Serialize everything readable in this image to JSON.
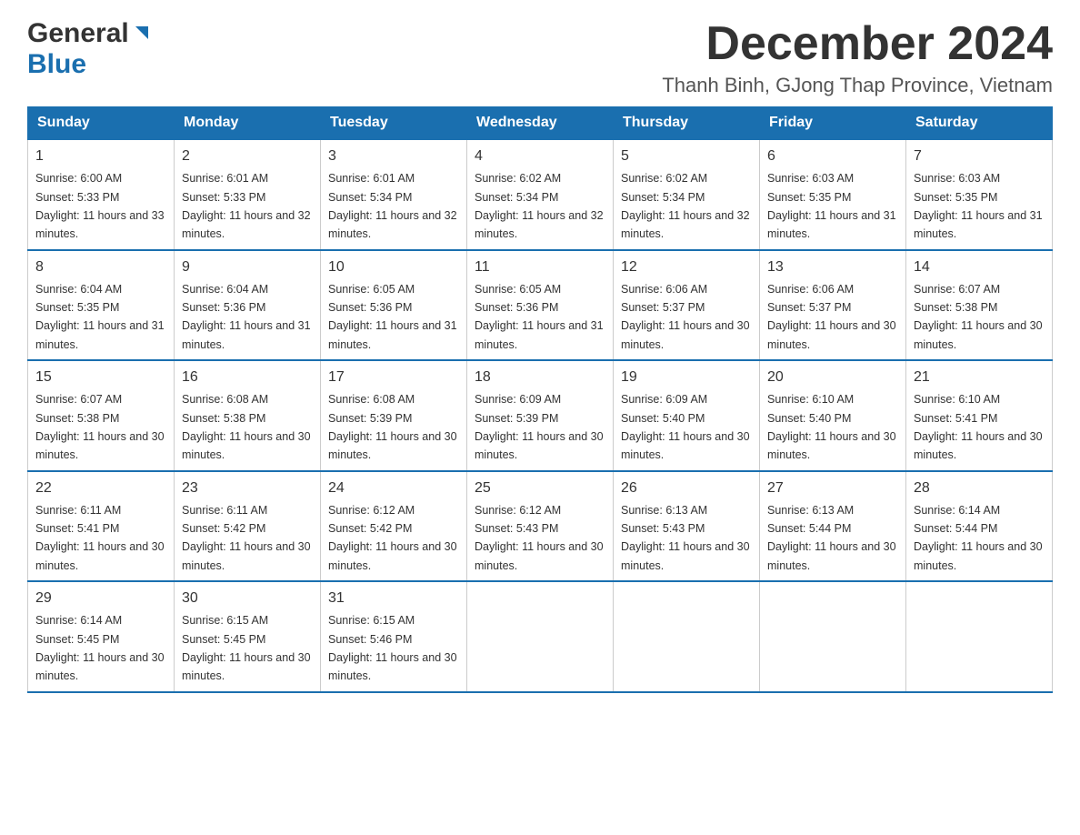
{
  "header": {
    "logo": {
      "general": "General",
      "blue": "Blue",
      "tagline": "GeneralBlue"
    },
    "title": "December 2024",
    "location": "Thanh Binh, GJong Thap Province, Vietnam"
  },
  "calendar": {
    "days": [
      "Sunday",
      "Monday",
      "Tuesday",
      "Wednesday",
      "Thursday",
      "Friday",
      "Saturday"
    ],
    "weeks": [
      [
        {
          "date": "1",
          "sunrise": "6:00 AM",
          "sunset": "5:33 PM",
          "daylight": "11 hours and 33 minutes."
        },
        {
          "date": "2",
          "sunrise": "6:01 AM",
          "sunset": "5:33 PM",
          "daylight": "11 hours and 32 minutes."
        },
        {
          "date": "3",
          "sunrise": "6:01 AM",
          "sunset": "5:34 PM",
          "daylight": "11 hours and 32 minutes."
        },
        {
          "date": "4",
          "sunrise": "6:02 AM",
          "sunset": "5:34 PM",
          "daylight": "11 hours and 32 minutes."
        },
        {
          "date": "5",
          "sunrise": "6:02 AM",
          "sunset": "5:34 PM",
          "daylight": "11 hours and 32 minutes."
        },
        {
          "date": "6",
          "sunrise": "6:03 AM",
          "sunset": "5:35 PM",
          "daylight": "11 hours and 31 minutes."
        },
        {
          "date": "7",
          "sunrise": "6:03 AM",
          "sunset": "5:35 PM",
          "daylight": "11 hours and 31 minutes."
        }
      ],
      [
        {
          "date": "8",
          "sunrise": "6:04 AM",
          "sunset": "5:35 PM",
          "daylight": "11 hours and 31 minutes."
        },
        {
          "date": "9",
          "sunrise": "6:04 AM",
          "sunset": "5:36 PM",
          "daylight": "11 hours and 31 minutes."
        },
        {
          "date": "10",
          "sunrise": "6:05 AM",
          "sunset": "5:36 PM",
          "daylight": "11 hours and 31 minutes."
        },
        {
          "date": "11",
          "sunrise": "6:05 AM",
          "sunset": "5:36 PM",
          "daylight": "11 hours and 31 minutes."
        },
        {
          "date": "12",
          "sunrise": "6:06 AM",
          "sunset": "5:37 PM",
          "daylight": "11 hours and 30 minutes."
        },
        {
          "date": "13",
          "sunrise": "6:06 AM",
          "sunset": "5:37 PM",
          "daylight": "11 hours and 30 minutes."
        },
        {
          "date": "14",
          "sunrise": "6:07 AM",
          "sunset": "5:38 PM",
          "daylight": "11 hours and 30 minutes."
        }
      ],
      [
        {
          "date": "15",
          "sunrise": "6:07 AM",
          "sunset": "5:38 PM",
          "daylight": "11 hours and 30 minutes."
        },
        {
          "date": "16",
          "sunrise": "6:08 AM",
          "sunset": "5:38 PM",
          "daylight": "11 hours and 30 minutes."
        },
        {
          "date": "17",
          "sunrise": "6:08 AM",
          "sunset": "5:39 PM",
          "daylight": "11 hours and 30 minutes."
        },
        {
          "date": "18",
          "sunrise": "6:09 AM",
          "sunset": "5:39 PM",
          "daylight": "11 hours and 30 minutes."
        },
        {
          "date": "19",
          "sunrise": "6:09 AM",
          "sunset": "5:40 PM",
          "daylight": "11 hours and 30 minutes."
        },
        {
          "date": "20",
          "sunrise": "6:10 AM",
          "sunset": "5:40 PM",
          "daylight": "11 hours and 30 minutes."
        },
        {
          "date": "21",
          "sunrise": "6:10 AM",
          "sunset": "5:41 PM",
          "daylight": "11 hours and 30 minutes."
        }
      ],
      [
        {
          "date": "22",
          "sunrise": "6:11 AM",
          "sunset": "5:41 PM",
          "daylight": "11 hours and 30 minutes."
        },
        {
          "date": "23",
          "sunrise": "6:11 AM",
          "sunset": "5:42 PM",
          "daylight": "11 hours and 30 minutes."
        },
        {
          "date": "24",
          "sunrise": "6:12 AM",
          "sunset": "5:42 PM",
          "daylight": "11 hours and 30 minutes."
        },
        {
          "date": "25",
          "sunrise": "6:12 AM",
          "sunset": "5:43 PM",
          "daylight": "11 hours and 30 minutes."
        },
        {
          "date": "26",
          "sunrise": "6:13 AM",
          "sunset": "5:43 PM",
          "daylight": "11 hours and 30 minutes."
        },
        {
          "date": "27",
          "sunrise": "6:13 AM",
          "sunset": "5:44 PM",
          "daylight": "11 hours and 30 minutes."
        },
        {
          "date": "28",
          "sunrise": "6:14 AM",
          "sunset": "5:44 PM",
          "daylight": "11 hours and 30 minutes."
        }
      ],
      [
        {
          "date": "29",
          "sunrise": "6:14 AM",
          "sunset": "5:45 PM",
          "daylight": "11 hours and 30 minutes."
        },
        {
          "date": "30",
          "sunrise": "6:15 AM",
          "sunset": "5:45 PM",
          "daylight": "11 hours and 30 minutes."
        },
        {
          "date": "31",
          "sunrise": "6:15 AM",
          "sunset": "5:46 PM",
          "daylight": "11 hours and 30 minutes."
        },
        null,
        null,
        null,
        null
      ]
    ]
  }
}
